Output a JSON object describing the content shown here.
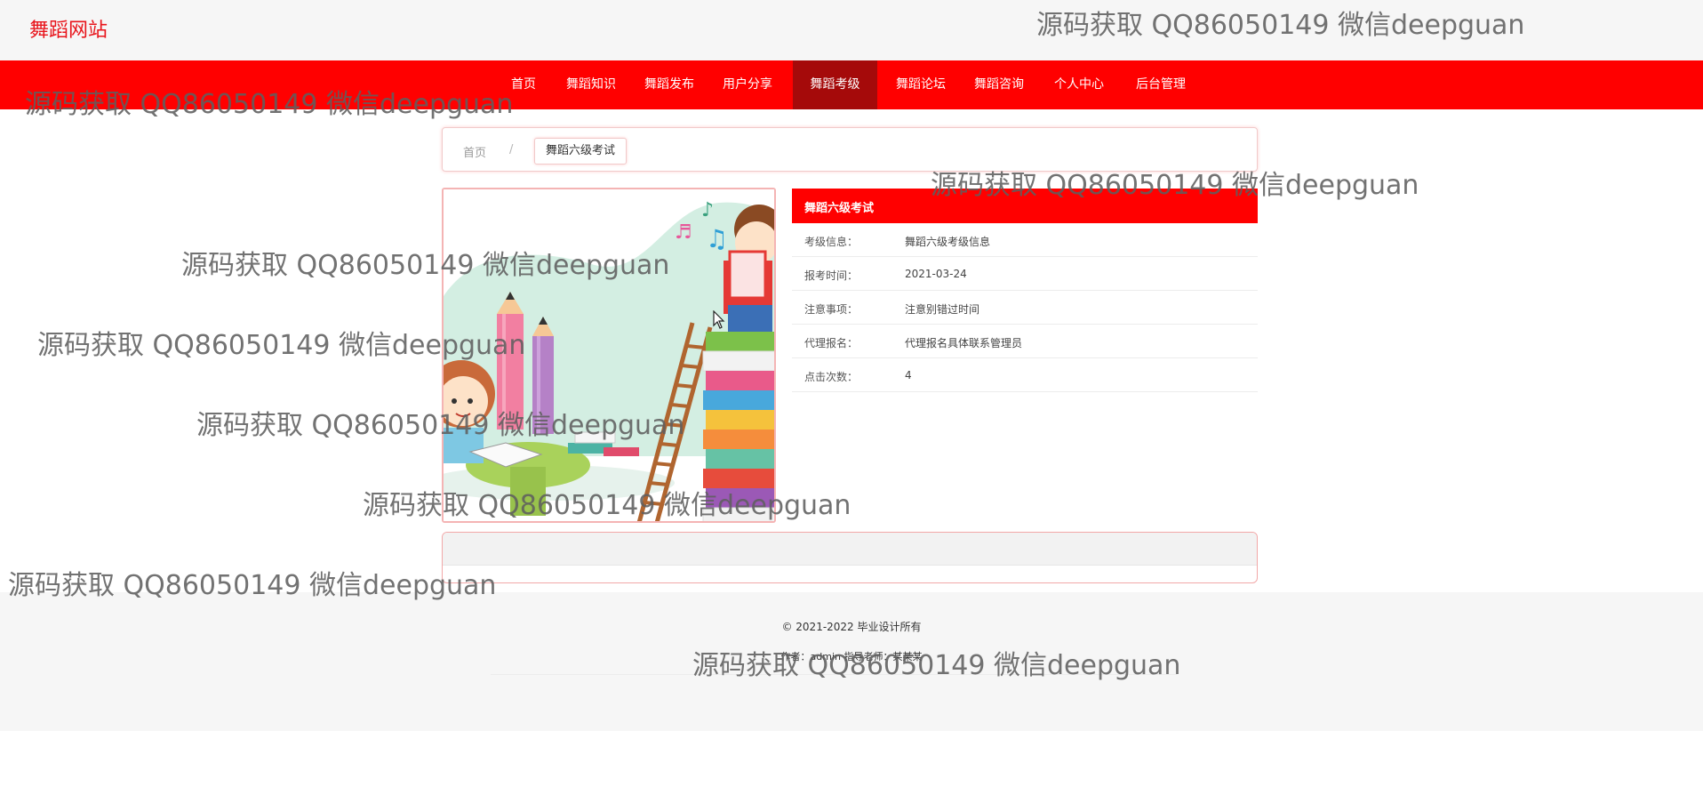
{
  "site": {
    "title": "舞蹈网站"
  },
  "nav": {
    "items": [
      {
        "label": "首页"
      },
      {
        "label": "舞蹈知识"
      },
      {
        "label": "舞蹈发布"
      },
      {
        "label": "用户分享"
      },
      {
        "label": "舞蹈考级",
        "active": true
      },
      {
        "label": "舞蹈论坛"
      },
      {
        "label": "舞蹈咨询"
      },
      {
        "label": "个人中心"
      },
      {
        "label": "后台管理"
      }
    ]
  },
  "breadcrumb": {
    "home": "首页",
    "separator": "/",
    "current": "舞蹈六级考试"
  },
  "detail": {
    "title": "舞蹈六级考试",
    "rows": [
      {
        "label": "考级信息：",
        "value": "舞蹈六级考级信息"
      },
      {
        "label": "报考时间：",
        "value": "2021-03-24"
      },
      {
        "label": "注意事项：",
        "value": "注意别错过时间"
      },
      {
        "label": "代理报名：",
        "value": "代理报名具体联系管理员"
      },
      {
        "label": "点击次数：",
        "value": "4"
      }
    ]
  },
  "footer": {
    "copyright": "© 2021-2022 毕业设计所有",
    "contact": "作者：admin 指导老师：某某某"
  },
  "watermark": {
    "text": "源码获取 QQ86050149 微信deepguan"
  },
  "colors": {
    "brand_red": "#ff0000",
    "active_nav": "#a50a0a",
    "logo_red": "#e8141b"
  },
  "icons": [
    "mouse-cursor-icon"
  ]
}
